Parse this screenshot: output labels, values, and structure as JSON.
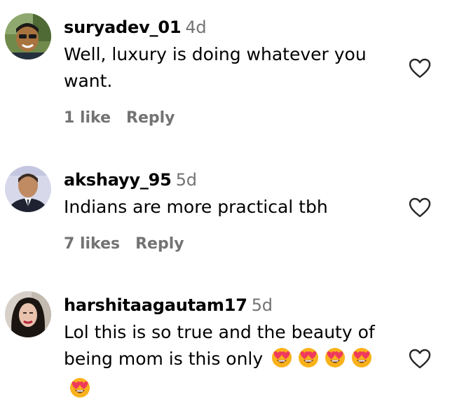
{
  "comments": [
    {
      "username": "suryadev_01",
      "time": "4d",
      "text": "Well, luxury is doing whatever you want.",
      "likes": "1 like",
      "reply": "Reply",
      "emoji_count": 0
    },
    {
      "username": "akshayy_95",
      "time": "5d",
      "text": "Indians are more practical tbh",
      "likes": "7 likes",
      "reply": "Reply",
      "emoji_count": 0
    },
    {
      "username": "harshitaagautam17",
      "time": "5d",
      "text": "Lol this is so true and the beauty of being mom is this only",
      "likes": "",
      "reply": "",
      "emoji": "smiling-face-with-heart-eyes",
      "emoji_count": 5
    }
  ],
  "colors": {
    "text": "#000000",
    "secondary": "#737373",
    "emoji_face": "#f9b21b",
    "emoji_heart": "#ef3a5d"
  },
  "icons": {
    "like": "heart-outline-icon"
  }
}
